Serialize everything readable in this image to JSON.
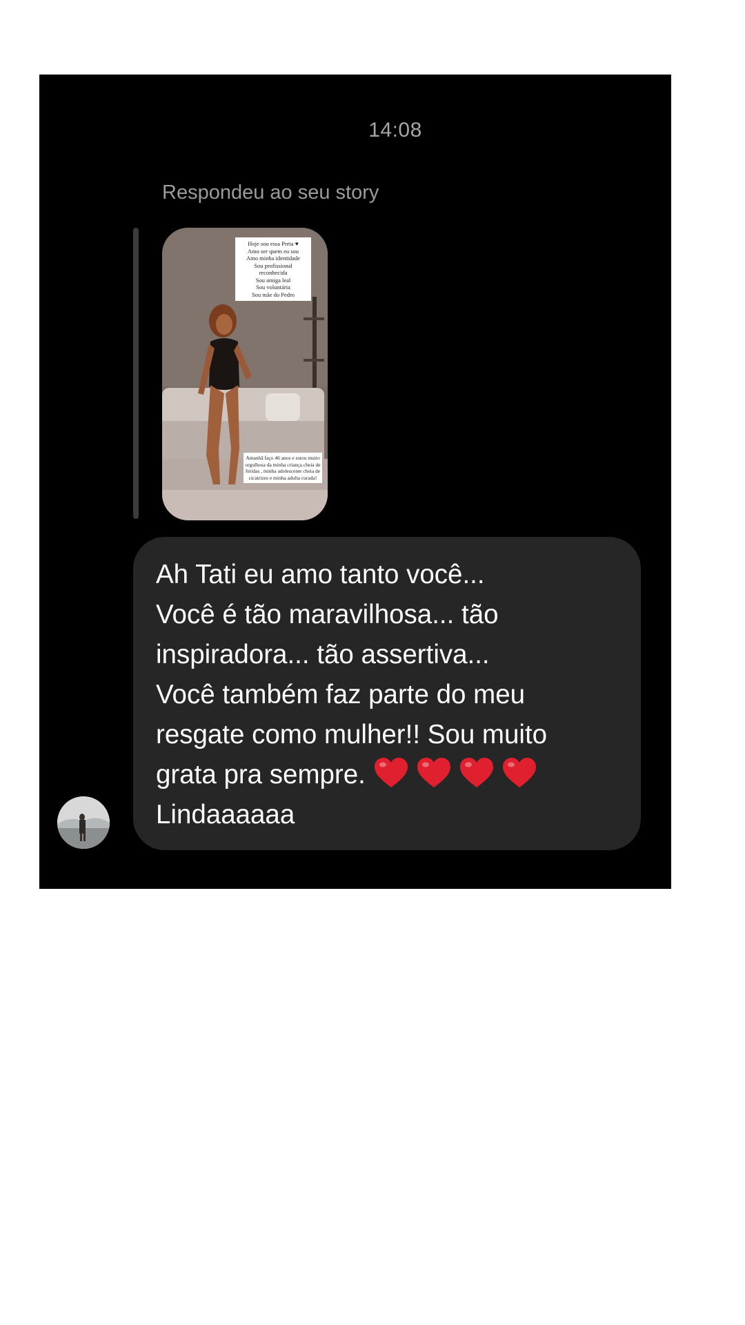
{
  "chat": {
    "timestamp": "14:08",
    "reply_caption": "Respondeu ao seu story",
    "story": {
      "text_top": "Hoje sou essa Preta ♥\nAmo ser quem eu sou\nAmo minha identidade\nSou profissional\nreconhecida\nSou amiga leal\nSou voluntária\nSou mãe do Pedro",
      "text_bottom": "Amanhã faço 46 anos e estou muito orgulhosa da minha criança cheia de feridas , minha adolescente cheia de cicatrizes e minha adulta curada!"
    },
    "message": {
      "lines": [
        "Ah Tati eu amo tanto você...",
        "Você é tão maravilhosa... tão",
        "inspiradora... tão assertiva...",
        "Você também faz parte do meu",
        "resgate como mulher!! Sou muito",
        "grata pra sempre.",
        "Lindaaaaaa"
      ],
      "heart_count": 4,
      "heart_color": "#e0202e"
    },
    "colors": {
      "background": "#000000",
      "bubble": "#262626",
      "text": "#ffffff",
      "muted_text": "#a6a6a6"
    }
  }
}
